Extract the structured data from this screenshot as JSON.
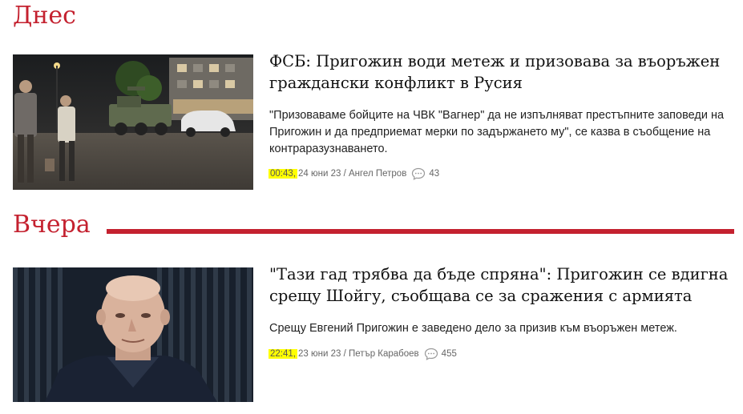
{
  "sections": [
    {
      "title": "Днес",
      "articles": [
        {
          "headline": "ФСБ: Пригожин води метеж и призовава за въоръжен граждански конфликт в Русия",
          "lead": "\"Призоваваме бойците на ЧВК \"Вагнер\" да не изпълняват престъпните заповеди на Пригожин и да предприемат мерки по задържането му\", се казва в съобщение на контраразузнаването.",
          "time": "00:43,",
          "date": "24 юни 23",
          "separator": "/",
          "author": "Ангел Петров",
          "comments": "43",
          "image_icon": "armored-vehicle-street-photo"
        }
      ]
    },
    {
      "title": "Вчера",
      "articles": [
        {
          "headline": "\"Тази гад трябва да бъде спряна\": Пригожин се вдигна срещу Шойгу, съобщава се за сражения с армията",
          "lead": "Срещу Евгений Пригожин е заведено дело за призив към въоръжен метеж.",
          "time": "22:41,",
          "date": "23 юни 23",
          "separator": "/",
          "author": "Петър Карабоев",
          "comments": "455",
          "image_icon": "portrait-photo"
        }
      ]
    }
  ],
  "colors": {
    "accent": "#c4212f",
    "highlight": "#ffff00",
    "meta_text": "#666666"
  }
}
